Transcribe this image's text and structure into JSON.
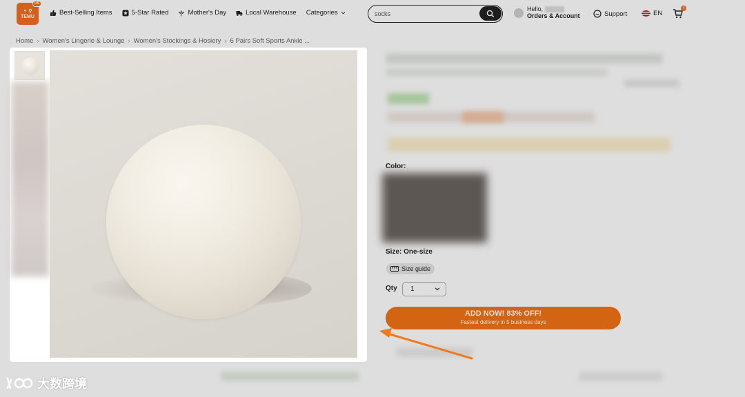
{
  "header": {
    "logo_text": "TEMU",
    "logo_badge": "US",
    "nav": [
      {
        "label": "Best-Selling Items",
        "icon": "thumbs-up-icon"
      },
      {
        "label": "5-Star Rated",
        "icon": "star-badge-icon"
      },
      {
        "label": "Mother's Day",
        "icon": "flower-icon"
      },
      {
        "label": "Local Warehouse",
        "icon": "truck-icon"
      },
      {
        "label": "Categories",
        "icon": "chevron-down-icon"
      }
    ],
    "search_value": "socks",
    "greeting": "Hello,",
    "account_label": "Orders & Account",
    "support_label": "Support",
    "language": "EN",
    "cart_count": "4"
  },
  "breadcrumb": [
    "Home",
    "Women's Lingerie & Lounge",
    "Women's Stockings & Hosiery",
    "6 Pairs Soft Sports Ankle ..."
  ],
  "product": {
    "color_label": "Color:",
    "size_label": "Size: One-size",
    "size_guide_label": "Size guide",
    "qty_label": "Qty",
    "qty_value": "1",
    "cta_title": "ADD NOW! 83% OFF!",
    "cta_subtitle": "Fastest delivery in 5 business days"
  },
  "watermark": "大数跨境",
  "colors": {
    "brand": "#f36f24",
    "cta": "#f27317",
    "arrow": "#f07a1c"
  }
}
